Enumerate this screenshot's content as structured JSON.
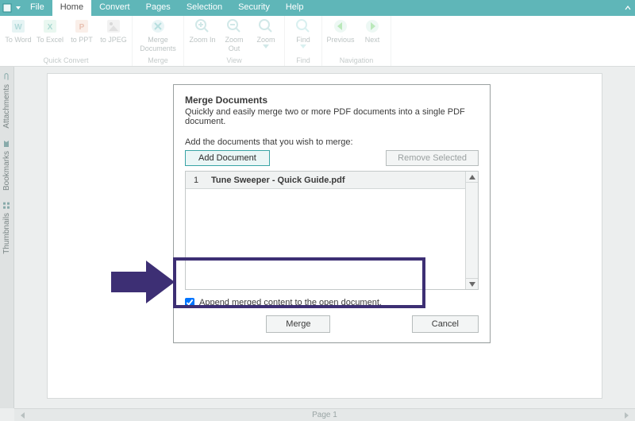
{
  "menu": {
    "file": "File",
    "home": "Home",
    "convert": "Convert",
    "pages": "Pages",
    "selection": "Selection",
    "security": "Security",
    "help": "Help"
  },
  "ribbon": {
    "quickconvert_label": "Quick Convert",
    "merge_label": "Merge",
    "view_label": "View",
    "find_label": "Find",
    "navigation_label": "Navigation",
    "btn": {
      "to_word": "To Word",
      "to_excel": "To Excel",
      "to_ppt": "to PPT",
      "to_jpeg": "to JPEG",
      "merge_docs_1": "Merge",
      "merge_docs_2": "Documents",
      "zoom_in": "Zoom In",
      "zoom_out_1": "Zoom",
      "zoom_out_2": "Out",
      "zoom": "Zoom",
      "find": "Find",
      "previous": "Previous",
      "next": "Next"
    }
  },
  "side": {
    "attachments": "Attachments",
    "bookmarks": "Bookmarks",
    "thumbnails": "Thumbnails"
  },
  "status": {
    "page": "Page 1"
  },
  "dialog": {
    "title": "Merge Documents",
    "subtitle": "Quickly and easily merge two or more PDF documents into a single PDF document.",
    "add_label": "Add the documents that you wish to merge:",
    "add_button": "Add Document",
    "remove_button": "Remove Selected",
    "list": {
      "row1_index": "1",
      "row1_name": "Tune Sweeper - Quick Guide.pdf"
    },
    "append_label": "Append merged content to the open document.",
    "append_checked": true,
    "merge_button": "Merge",
    "cancel_button": "Cancel"
  }
}
